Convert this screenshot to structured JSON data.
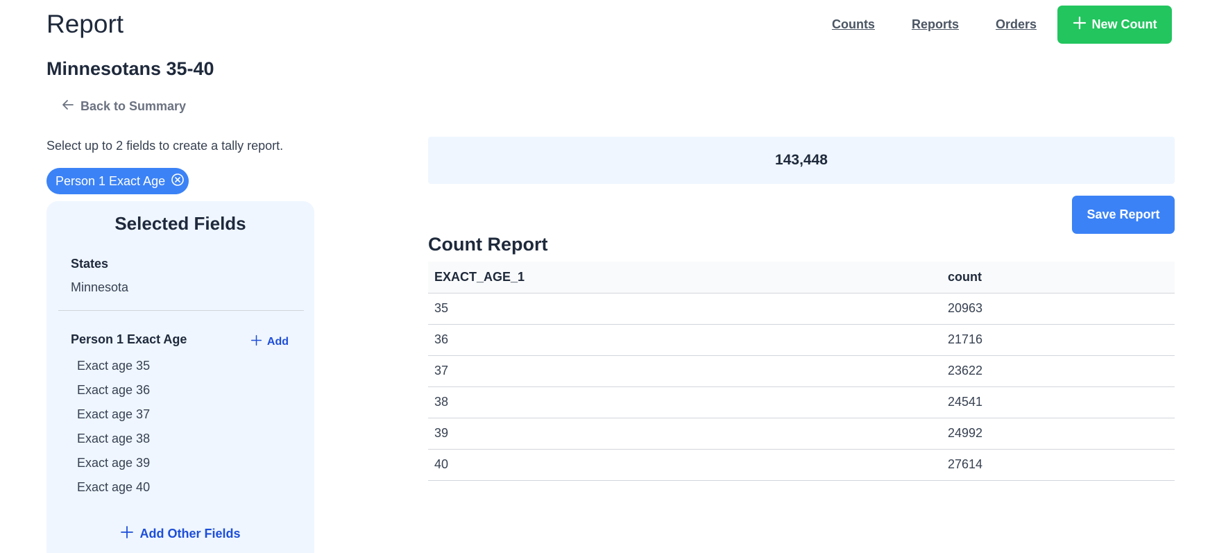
{
  "header": {
    "title": "Report",
    "nav": [
      "Counts",
      "Reports",
      "Orders"
    ],
    "new_count_label": "New Count"
  },
  "report_name": "Minnesotans 35-40",
  "back_label": "Back to Summary",
  "hint": "Select up to 2 fields to create a tally report.",
  "chip_label": "Person 1 Exact Age",
  "panel": {
    "title": "Selected Fields",
    "states_label": "States",
    "states_value": "Minnesota",
    "age_label": "Person 1 Exact Age",
    "add_label": "Add",
    "ages": [
      "Exact age 35",
      "Exact age 36",
      "Exact age 37",
      "Exact age 38",
      "Exact age 39",
      "Exact age 40"
    ],
    "add_other_label": "Add Other Fields"
  },
  "total": "143,448",
  "save_label": "Save Report",
  "table": {
    "title": "Count Report",
    "headers": [
      "EXACT_AGE_1",
      "count"
    ],
    "rows": [
      [
        "35",
        "20963"
      ],
      [
        "36",
        "21716"
      ],
      [
        "37",
        "23622"
      ],
      [
        "38",
        "24541"
      ],
      [
        "39",
        "24992"
      ],
      [
        "40",
        "27614"
      ]
    ]
  }
}
